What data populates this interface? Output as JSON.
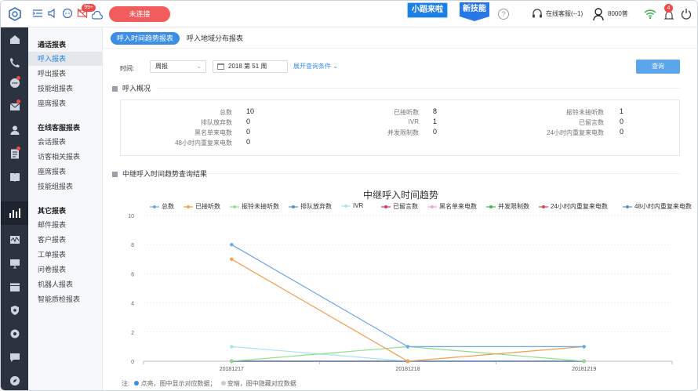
{
  "topbar": {
    "status_button": "未连接",
    "notify_badge": "99+",
    "promo_1": "小蹈来啦",
    "promo_2": "新技能",
    "help": "?",
    "online_cs": "在线客服(--1)",
    "extension": "8000普",
    "alert_badge": "4",
    "accent": "#3a8ee6",
    "status_color": "#f15c5c"
  },
  "icon_bar": [
    "home-icon",
    "phone-icon",
    "chat-icon",
    "mail-icon",
    "user-icon",
    "clipboard-icon",
    "book-icon",
    "report-icon",
    "wave-icon",
    "monitor-icon",
    "calendar-icon",
    "shield-icon",
    "gear-icon",
    "message-icon",
    "compass-icon"
  ],
  "menu": {
    "groups": [
      {
        "title": "通话报表",
        "items": [
          "呼入报表",
          "呼出报表",
          "技能组报表",
          "座席报表"
        ]
      },
      {
        "title": "在线客服报表",
        "items": [
          "会话报表",
          "访客相关报表",
          "座席报表",
          "技能组报表"
        ]
      },
      {
        "title": "其它报表",
        "items": [
          "邮件报表",
          "客户报表",
          "工单报表",
          "问卷报表",
          "机器人报表",
          "智能质检报表"
        ]
      }
    ]
  },
  "tabs": [
    "呼入时间趋势报表",
    "呼入地域分布报表"
  ],
  "filter": {
    "label": "时间:",
    "period": "周报",
    "date": "2018 第 51 周",
    "expand": "展开查询条件",
    "query": "查询"
  },
  "summary": {
    "title": "呼入概况",
    "columns": [
      [
        {
          "label": "总数",
          "value": "10"
        },
        {
          "label": "排队放弃数",
          "value": "0"
        },
        {
          "label": "黑名单来电数",
          "value": "0"
        },
        {
          "label": "48小时内重复来电数",
          "value": "0"
        }
      ],
      [
        {
          "label": "已接听数",
          "value": "8"
        },
        {
          "label": "IVR",
          "value": "1"
        },
        {
          "label": "并发限制数",
          "value": "0"
        }
      ],
      [
        {
          "label": "振铃未接听数",
          "value": "1"
        },
        {
          "label": "已留言数",
          "value": "0"
        },
        {
          "label": "24小时内重复来电数",
          "value": "0"
        }
      ]
    ]
  },
  "result_title": "中继呼入时间趋势查询结果",
  "chart_data": {
    "type": "line",
    "title": "中继呼入时间趋势",
    "categories": [
      "20181217",
      "20181218",
      "20181219"
    ],
    "ylim": [
      0,
      10
    ],
    "yticks": [
      "0",
      "2",
      "4",
      "6",
      "8",
      "10"
    ],
    "grid": true,
    "legend_position": "top",
    "series": [
      {
        "name": "总数",
        "values": [
          8,
          1,
          1
        ],
        "color": "#6aa8e8"
      },
      {
        "name": "已接听数",
        "values": [
          7,
          0,
          1
        ],
        "color": "#f0a050"
      },
      {
        "name": "振铃未接听数",
        "values": [
          0,
          1,
          0
        ],
        "color": "#8ee08a"
      },
      {
        "name": "排队放弃数",
        "values": [
          0,
          0,
          0
        ],
        "color": "#5b8cc0"
      },
      {
        "name": "IVR",
        "values": [
          1,
          0,
          0
        ],
        "color": "#a8e4f0"
      },
      {
        "name": "已留言数",
        "values": [
          0,
          0,
          0
        ],
        "color": "#e0306a"
      },
      {
        "name": "黑名单来电数",
        "values": [
          0,
          0,
          0
        ],
        "color": "#e8a8e0"
      },
      {
        "name": "并发限制数",
        "values": [
          0,
          0,
          0
        ],
        "color": "#3cb84c"
      },
      {
        "name": "24小时内重复来电数",
        "values": [
          0,
          0,
          0
        ],
        "color": "#e04848"
      },
      {
        "name": "48小时内重复来电数",
        "values": [
          0,
          0,
          0
        ],
        "color": "#6a8cb0"
      }
    ]
  },
  "footnote": {
    "prefix": "注:",
    "lit": "点亮，图中显示对应数据；",
    "dim": "变暗，图中隐藏对应数据",
    "lit_color": "#3a8ee6",
    "dim_color": "#cccccc"
  }
}
